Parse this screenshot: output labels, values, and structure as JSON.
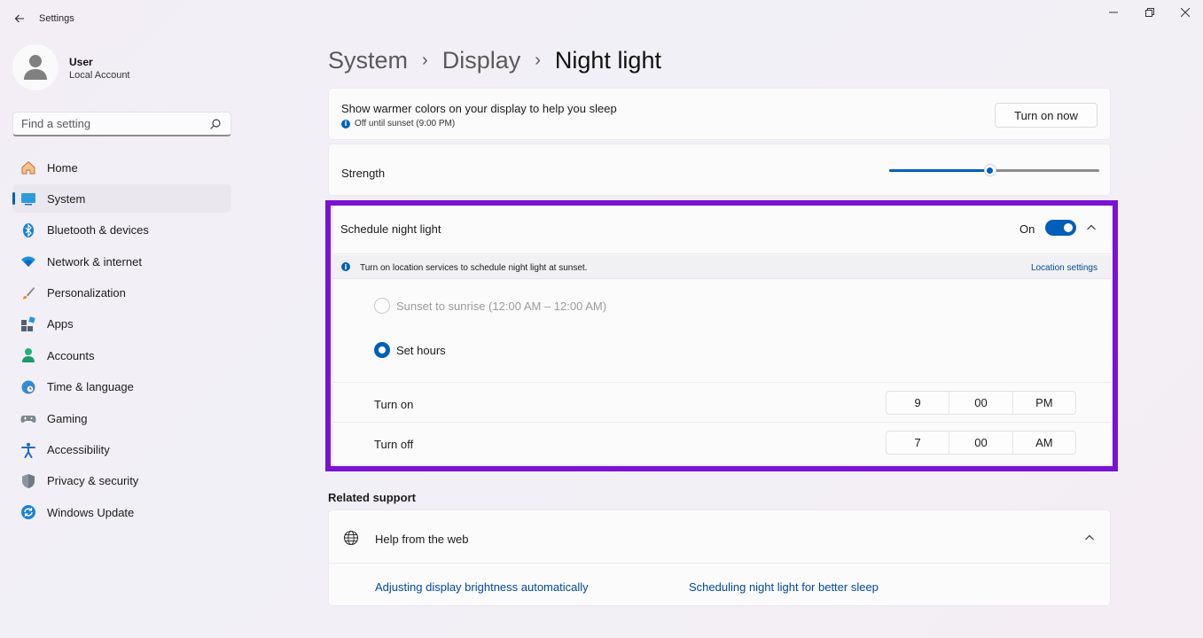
{
  "window": {
    "title": "Settings"
  },
  "user": {
    "name": "User",
    "account_type": "Local Account"
  },
  "search": {
    "placeholder": "Find a setting"
  },
  "sidebar": {
    "items": [
      {
        "label": "Home",
        "icon": "home-icon"
      },
      {
        "label": "System",
        "icon": "system-icon",
        "active": true
      },
      {
        "label": "Bluetooth & devices",
        "icon": "bluetooth-icon"
      },
      {
        "label": "Network & internet",
        "icon": "wifi-icon"
      },
      {
        "label": "Personalization",
        "icon": "brush-icon"
      },
      {
        "label": "Apps",
        "icon": "apps-icon"
      },
      {
        "label": "Accounts",
        "icon": "accounts-icon"
      },
      {
        "label": "Time & language",
        "icon": "globe-clock-icon"
      },
      {
        "label": "Gaming",
        "icon": "gamepad-icon"
      },
      {
        "label": "Accessibility",
        "icon": "accessibility-icon"
      },
      {
        "label": "Privacy & security",
        "icon": "shield-icon"
      },
      {
        "label": "Windows Update",
        "icon": "update-icon"
      }
    ]
  },
  "breadcrumb": {
    "level1": "System",
    "level2": "Display",
    "current": "Night light"
  },
  "night_light": {
    "description": "Show warmer colors on your display to help you sleep",
    "status": "Off until sunset (9:00 PM)",
    "turn_on_button": "Turn on now"
  },
  "strength": {
    "label": "Strength",
    "value_fraction": 0.48
  },
  "schedule": {
    "title": "Schedule night light",
    "toggle_label": "On",
    "location_notice": "Turn on location services to schedule night light at sunset.",
    "location_link": "Location settings",
    "option_sunset": "Sunset to sunrise (12:00 AM – 12:00 AM)",
    "option_set_hours": "Set hours",
    "turn_on": {
      "label": "Turn on",
      "hour": "9",
      "minute": "00",
      "period": "PM"
    },
    "turn_off": {
      "label": "Turn off",
      "hour": "7",
      "minute": "00",
      "period": "AM"
    }
  },
  "related": {
    "title": "Related support",
    "help_title": "Help from the web",
    "links": [
      "Adjusting display brightness automatically",
      "Scheduling night light for better sleep"
    ]
  },
  "colors": {
    "accent": "#005fb8",
    "highlight": "#7b12d1"
  }
}
